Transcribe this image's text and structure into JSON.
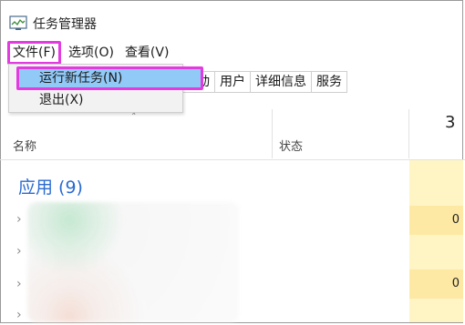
{
  "window": {
    "title": "任务管理器",
    "icon": "task-manager-icon"
  },
  "menubar": {
    "items": [
      "文件(F)",
      "选项(O)",
      "查看(V)"
    ]
  },
  "file_menu": {
    "items": [
      "运行新任务(N)",
      "退出(X)"
    ]
  },
  "tabs": [
    "启动",
    "用户",
    "详细信息",
    "服务"
  ],
  "columns": {
    "name": "名称",
    "status": "状态",
    "cpu_percent": "3"
  },
  "group": {
    "label": "应用 (9)"
  },
  "cpu_values": [
    "0",
    "0"
  ],
  "colors": {
    "highlight_border": "#e23be0",
    "menu_highlight": "#91c9f7",
    "group_text": "#2a6bd0",
    "cpu_column": "#fff4c4"
  }
}
